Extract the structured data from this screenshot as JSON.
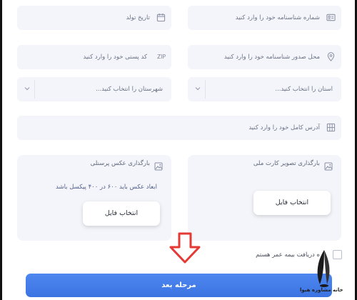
{
  "form": {
    "birth_date_placeholder": "تاریخ تولد",
    "id_number_placeholder": "شماره شناسنامه خود را وارد کنید",
    "postal_code_placeholder": "کد پستی خود را وارد کنید",
    "postal_code_prefix": "ZIP",
    "issue_place_placeholder": "محل صدور شناسنامه خود را وارد کنید",
    "city_select_value": "شهرستان را انتخاب کنید...",
    "province_select_value": "استان را انتخاب کنید...",
    "address_placeholder": "آدرس کامل خود را وارد کنید"
  },
  "uploads": {
    "personal_photo": {
      "title": "بارگذاری عکس پرسنلی",
      "note": "ابعاد عکس باید ۶۰۰ در ۴۰۰ پیکسل باشد",
      "button_label": "انتخاب فایل"
    },
    "national_card": {
      "title": "بارگذاری تصویر کارت ملی",
      "button_label": "انتخاب فایل"
    }
  },
  "consent": {
    "label": "ه دریافت بیمه عمر هستم"
  },
  "actions": {
    "next_label": "مرحله بعد"
  },
  "logo": {
    "text": "خانه مشاوره هیوا"
  },
  "colors": {
    "accent": "#3b74e2",
    "arrow": "#e53935",
    "field_bg": "#f3f5fa"
  }
}
